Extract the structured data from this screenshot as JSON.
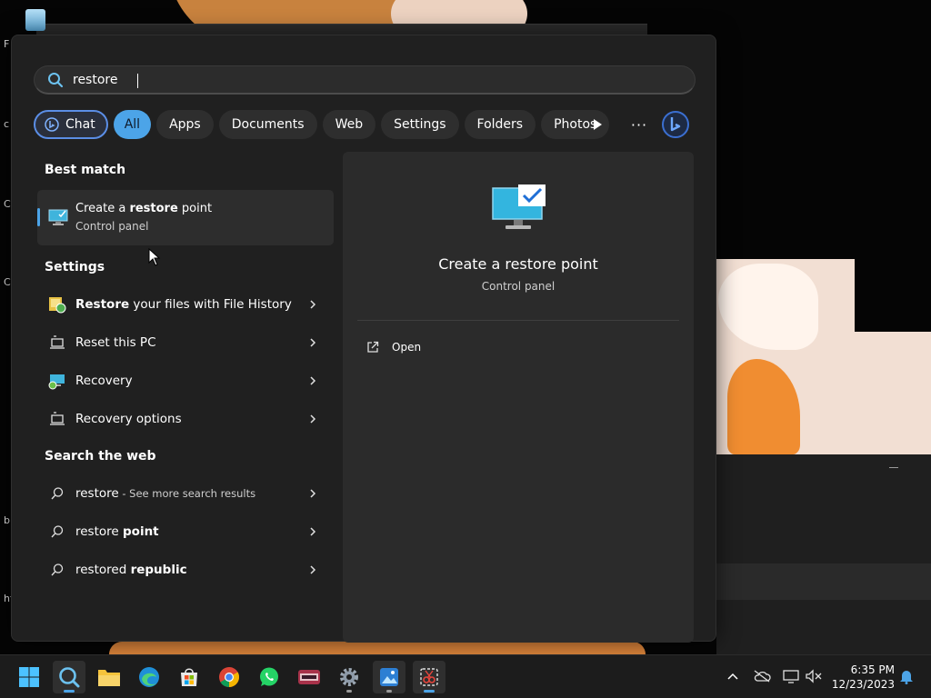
{
  "desktop": {
    "labels": [
      "F",
      "c",
      "C",
      "C",
      "bı",
      "ht"
    ]
  },
  "search": {
    "value": "restore",
    "placeholder": "",
    "icon": "search-icon"
  },
  "filters": {
    "chat_label": "Chat",
    "items": [
      "All",
      "Apps",
      "Documents",
      "Web",
      "Settings",
      "Folders",
      "Photos"
    ],
    "active": "All",
    "more_label": "···"
  },
  "best_match": {
    "title": "Best match",
    "item": {
      "name_pre": "Create a ",
      "name_bold": "restore",
      "name_post": " point",
      "subtitle": "Control panel",
      "icon": "computer-check-icon"
    }
  },
  "settings": {
    "title": "Settings",
    "items": [
      {
        "bold": "Restore",
        "text": " your files with File History",
        "icon": "file-history-icon"
      },
      {
        "bold": "",
        "text": "Reset this PC",
        "icon": "reset-pc-icon"
      },
      {
        "bold": "",
        "text": "Recovery",
        "icon": "recovery-icon"
      },
      {
        "bold": "",
        "text": "Recovery options",
        "icon": "recovery-options-icon"
      }
    ]
  },
  "web": {
    "title": "Search the web",
    "items": [
      {
        "pre": "restore",
        "bold": "",
        "sub": " - See more search results"
      },
      {
        "pre": "restore ",
        "bold": "point",
        "sub": ""
      },
      {
        "pre": "restored ",
        "bold": "republic",
        "sub": ""
      }
    ]
  },
  "preview": {
    "title": "Create a restore point",
    "subtitle": "Control panel",
    "open_label": "Open"
  },
  "taskbar": {
    "apps": [
      "start",
      "search",
      "file-explorer",
      "edge",
      "store",
      "chrome",
      "whatsapp",
      "game",
      "settings",
      "photos",
      "snipping-tool"
    ]
  },
  "clock": {
    "time": "6:35 PM",
    "date": "12/23/2023"
  },
  "colors": {
    "accent": "#4ca4e8",
    "panel": "#202020",
    "preview": "#2b2b2b",
    "taskbar": "#1c1c1c"
  }
}
